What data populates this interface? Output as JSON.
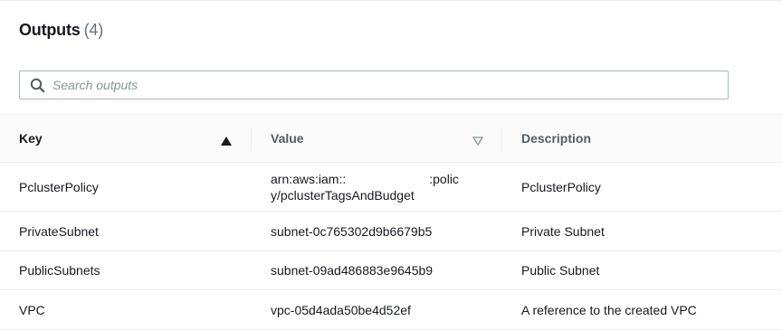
{
  "outputs": {
    "title": "Outputs",
    "count": "(4)"
  },
  "search": {
    "placeholder": "Search outputs",
    "value": ""
  },
  "table": {
    "columns": {
      "key": "Key",
      "value": "Value",
      "description": "Description"
    },
    "rows": [
      {
        "key": "PclusterPolicy",
        "value_line1_prefix": "arn:aws:iam::",
        "value_line1_suffix": ":polic",
        "value_line2": "y/pclusterTagsAndBudget",
        "description": "PclusterPolicy"
      },
      {
        "key": "PrivateSubnet",
        "value": "subnet-0c765302d9b6679b5",
        "description": "Private Subnet"
      },
      {
        "key": "PublicSubnets",
        "value": "subnet-09ad486883e9645b9",
        "description": "Public Subnet"
      },
      {
        "key": "VPC",
        "value": "vpc-05d4ada50be4d52ef",
        "description": "A reference to the created VPC"
      }
    ]
  },
  "icons": {
    "search": "search-icon",
    "sort_asc": "sort-ascending-icon",
    "sort_desc": "sort-descending-icon"
  }
}
